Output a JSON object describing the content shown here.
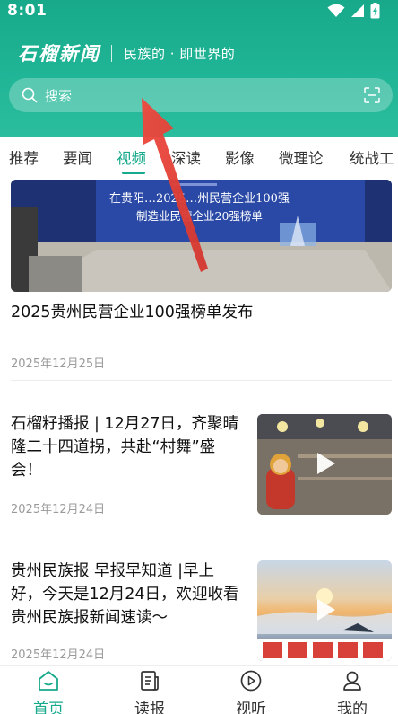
{
  "status_bar": {
    "time": "8:01",
    "icons": [
      "wifi-icon",
      "signal-icon",
      "battery-icon"
    ]
  },
  "header": {
    "logo_text": "石榴新闻",
    "slogan": "民族的 · 即世界的",
    "search": {
      "placeholder": "搜索",
      "left_icon": "search-icon",
      "right_icon": "scan-icon"
    }
  },
  "tabs": [
    {
      "label": "推荐",
      "active": false
    },
    {
      "label": "要闻",
      "active": false
    },
    {
      "label": "视频",
      "active": true
    },
    {
      "label": "深读",
      "active": false
    },
    {
      "label": "影像",
      "active": false
    },
    {
      "label": "微理论",
      "active": false
    },
    {
      "label": "统战工",
      "active": false
    }
  ],
  "feed": {
    "hero": {
      "image_text_line1": "在贵阳…2025…州民营企业100强",
      "image_text_line2": "制造业民营企业20强榜单",
      "title": "2025贵州民营企业100强榜单发布",
      "date": "2025年12月25日"
    },
    "items": [
      {
        "title": "石榴籽播报 | 12月27日，齐聚晴隆二十四道拐，共赴“村舞”盛会！",
        "date": "2025年12月24日",
        "thumb_type": "video"
      },
      {
        "title": "贵州民族报 早报早知道 |早上好，今天是12月24日，欢迎收看贵州民族报新闻速读～",
        "date": "2025年12月24日",
        "thumb_type": "video"
      }
    ]
  },
  "bottom_nav": [
    {
      "label": "首页",
      "icon": "home-icon",
      "active": true
    },
    {
      "label": "读报",
      "icon": "newspaper-icon",
      "active": false
    },
    {
      "label": "视听",
      "icon": "play-circle-icon",
      "active": false
    },
    {
      "label": "我的",
      "icon": "user-icon",
      "active": false
    }
  ],
  "colors": {
    "brand_green": "#16a98b",
    "header_green": "#20b596",
    "text": "#111111",
    "meta": "#9a9a9a",
    "arrow_red": "#e8453c"
  }
}
